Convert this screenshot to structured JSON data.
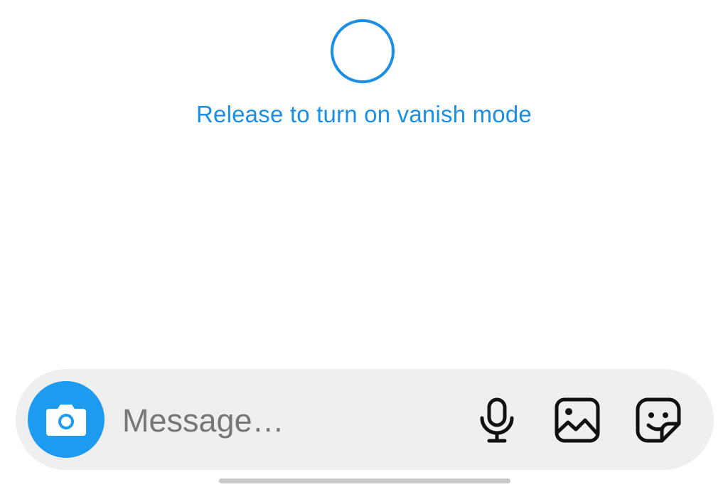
{
  "vanish_mode": {
    "prompt": "Release to turn on vanish mode"
  },
  "composer": {
    "placeholder": "Message…",
    "camera_icon": "camera-icon",
    "mic_icon": "microphone-icon",
    "gallery_icon": "image-icon",
    "sticker_icon": "sticker-icon"
  },
  "colors": {
    "accent": "#1a8fe3",
    "camera_button": "#1d9bf0",
    "composer_bg": "#efefef",
    "icon": "#111111"
  }
}
